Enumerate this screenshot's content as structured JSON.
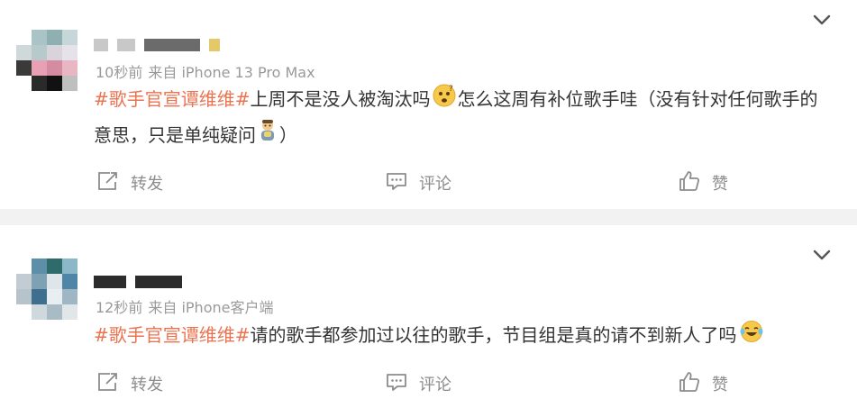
{
  "posts": [
    {
      "time": "10秒前",
      "source": "来自 iPhone 13 Pro Max",
      "topic": "#歌手官宣谭维维#",
      "text_part1": "上周不是没人被淘汰吗",
      "emoji1": "confused-face",
      "text_part2": "怎么这周有补位歌手哇（没有针对任何歌手的意思，只是单纯疑问",
      "emoji2": "worried-person",
      "text_part3": "）",
      "repost_label": "转发",
      "comment_label": "评论",
      "like_label": "赞"
    },
    {
      "time": "12秒前",
      "source": "来自 iPhone客户端",
      "topic": "#歌手官宣谭维维#",
      "text_part1": "请的歌手都参加过以往的歌手，节目组是真的请不到新人了吗",
      "emoji1": "laugh-cry-face",
      "repost_label": "转发",
      "comment_label": "评论",
      "like_label": "赞"
    }
  ],
  "colors": {
    "topic": "#eb7350",
    "meta": "#9a9a9a",
    "text": "#333333",
    "action": "#8c8c8c",
    "background": "#f2f2f2",
    "card": "#ffffff"
  },
  "icons": [
    "chevron-down-icon",
    "repost-icon",
    "comment-icon",
    "thumb-up-icon"
  ]
}
